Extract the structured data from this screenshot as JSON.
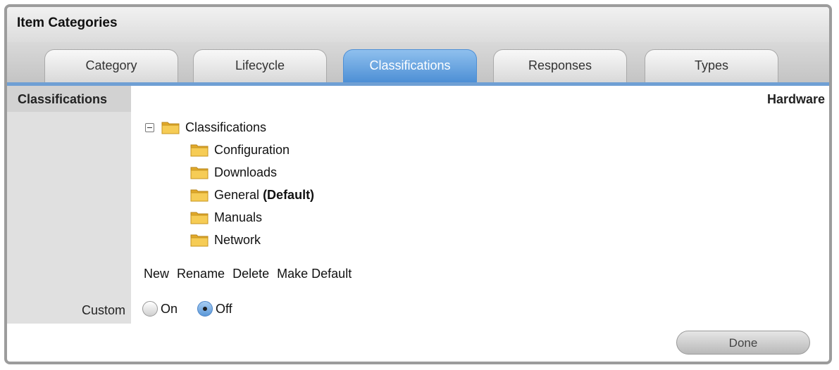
{
  "panel": {
    "title": "Item Categories"
  },
  "tabs": [
    {
      "label": "Category",
      "active": false
    },
    {
      "label": "Lifecycle",
      "active": false
    },
    {
      "label": "Classifications",
      "active": true
    },
    {
      "label": "Responses",
      "active": false
    },
    {
      "label": "Types",
      "active": false
    }
  ],
  "section": {
    "title": "Classifications",
    "record_name": "Hardware"
  },
  "tree": {
    "root": {
      "label": "Classifications",
      "icon": "folder-icon",
      "toggle_icon": "collapse-icon"
    },
    "children": [
      {
        "label": "Configuration",
        "suffix": ""
      },
      {
        "label": "Downloads",
        "suffix": ""
      },
      {
        "label": "General",
        "suffix": "(Default)"
      },
      {
        "label": "Manuals",
        "suffix": ""
      },
      {
        "label": "Network",
        "suffix": ""
      }
    ]
  },
  "actions": {
    "new": "New",
    "rename": "Rename",
    "delete": "Delete",
    "make_default": "Make Default"
  },
  "custom": {
    "label": "Custom",
    "options": [
      {
        "label": "On",
        "checked": false
      },
      {
        "label": "Off",
        "checked": true
      }
    ]
  },
  "buttons": {
    "done": "Done"
  },
  "colors": {
    "active_tab": "#5b98d9",
    "tab_underline": "#6f9fd4",
    "folder": "#f0c040"
  }
}
